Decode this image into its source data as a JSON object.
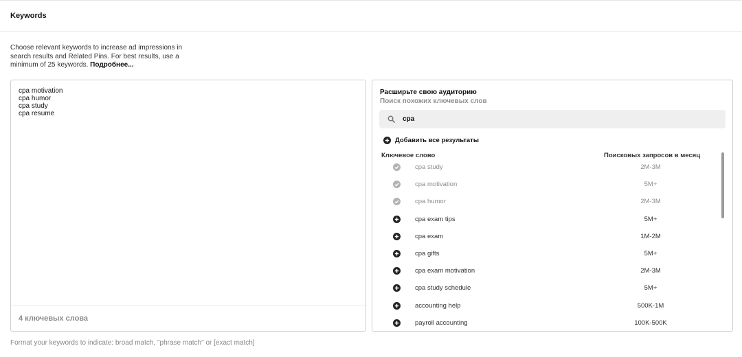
{
  "header": {
    "title": "Keywords"
  },
  "description": {
    "text": "Choose relevant keywords to increase ad impressions in search results and Related Pins. For best results, use a minimum of 25 keywords.",
    "link": "Подробнее..."
  },
  "keywords_box": {
    "keywords": [
      "cpa motivation",
      "cpa humor",
      "cpa study",
      "cpa resume"
    ],
    "count_label": "4 ключевых слова"
  },
  "expand": {
    "title": "Расширьте свою аудиторию",
    "subtitle": "Поиск похожих ключевых слов",
    "search_value": "cpa",
    "add_all_label": "Добавить все результаты",
    "col_keyword": "Ключевое слово",
    "col_volume": "Поисковых запросов в месяц",
    "rows": [
      {
        "keyword": "cpa study",
        "volume": "2M-3M",
        "added": true
      },
      {
        "keyword": "cpa motivation",
        "volume": "5M+",
        "added": true
      },
      {
        "keyword": "cpa humor",
        "volume": "2M-3M",
        "added": true
      },
      {
        "keyword": "cpa exam tips",
        "volume": "5M+",
        "added": false
      },
      {
        "keyword": "cpa exam",
        "volume": "1M-2M",
        "added": false
      },
      {
        "keyword": "cpa gifts",
        "volume": "5M+",
        "added": false
      },
      {
        "keyword": "cpa exam motivation",
        "volume": "2M-3M",
        "added": false
      },
      {
        "keyword": "cpa study schedule",
        "volume": "5M+",
        "added": false
      },
      {
        "keyword": "accounting help",
        "volume": "500K-1M",
        "added": false
      },
      {
        "keyword": "payroll accounting",
        "volume": "100K-500K",
        "added": false
      }
    ]
  },
  "format_hint": "Format your keywords to indicate: broad match, \"phrase match\" or [exact match]",
  "icons": {
    "added": "check-circle-icon",
    "add": "plus-circle-icon",
    "search": "search-icon"
  },
  "colors": {
    "added_icon": "#b3b3b3",
    "add_icon": "#222222",
    "search_bg": "#efefef"
  }
}
